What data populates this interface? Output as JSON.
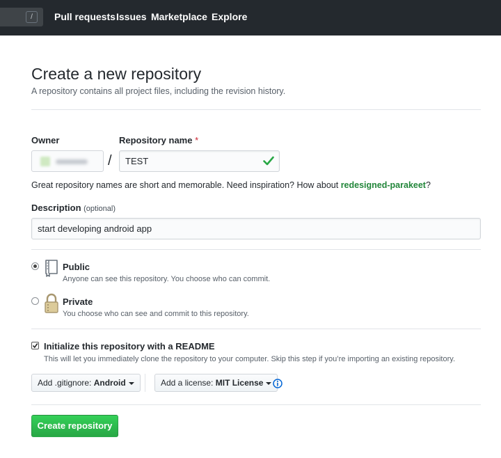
{
  "header": {
    "search_shortcut": "/",
    "nav": [
      "Pull requests",
      "Issues",
      "Marketplace",
      "Explore"
    ]
  },
  "page": {
    "title": "Create a new repository",
    "subtitle": "A repository contains all project files, including the revision history."
  },
  "form": {
    "owner_label": "Owner",
    "repo_name_label": "Repository name",
    "required_mark": "*",
    "separator": "/",
    "repo_name_value": "TEST",
    "name_hint": "Great repository names are short and memorable. Need inspiration? How about",
    "name_suggestion": "redesigned-parakeet",
    "name_hint_end": "?",
    "description_label": "Description",
    "description_optional": "(optional)",
    "description_value": "start developing android app"
  },
  "visibility": {
    "selected": "public",
    "public_title": "Public",
    "public_desc": "Anyone can see this repository. You choose who can commit.",
    "private_title": "Private",
    "private_desc": "You choose who can see and commit to this repository."
  },
  "init": {
    "checked": true,
    "title": "Initialize this repository with a README",
    "desc": "This will let you immediately clone the repository to your computer. Skip this step if you’re importing an existing repository."
  },
  "gitignore": {
    "prefix": "Add .gitignore:",
    "value": "Android"
  },
  "license": {
    "prefix": "Add a license:",
    "value": "MIT License"
  },
  "submit_label": "Create repository",
  "colors": {
    "header_bg": "#24292e",
    "suggestion": "#22863a",
    "valid_check": "#28a745",
    "primary_button": "#2ea44f",
    "info_icon": "#0366d6",
    "required": "#cb2431",
    "repo_icon": "#a89770"
  }
}
